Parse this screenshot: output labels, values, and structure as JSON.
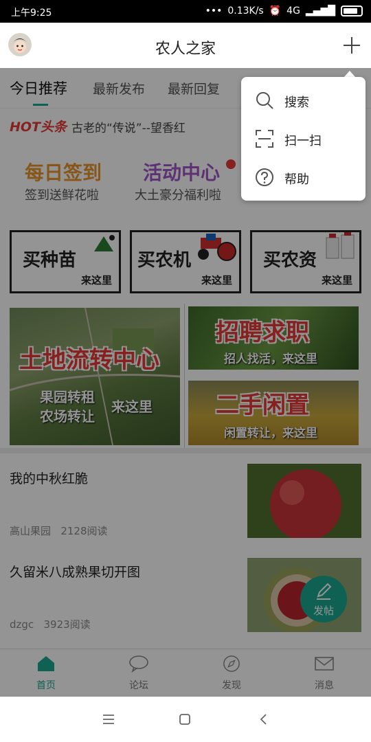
{
  "status_bar": {
    "time": "上午9:25",
    "network_speed": "0.13K/s",
    "network_type": "4G"
  },
  "header": {
    "title": "农人之家"
  },
  "tabs": [
    {
      "label": "今日推荐",
      "active": true
    },
    {
      "label": "最新发布",
      "active": false
    },
    {
      "label": "最新回复",
      "active": false
    }
  ],
  "hot": {
    "logo": "HOT头条",
    "headline": "古老的“传说”--望香红"
  },
  "promo": {
    "sign_in": {
      "title": "每日签到",
      "subtitle": "签到送鲜花啦"
    },
    "activity": {
      "title": "活动中心",
      "subtitle": "大土豪分福利啦"
    }
  },
  "categories": [
    {
      "title": "买种苗",
      "tag": "来这里"
    },
    {
      "title": "买农机",
      "tag": "来这里"
    },
    {
      "title": "买农资",
      "tag": "来这里"
    }
  ],
  "banners": {
    "land": {
      "title": "土地流转中心",
      "line1": "果园转租",
      "line2": "农场转让",
      "tag": "来这里"
    },
    "jobs": {
      "title": "招聘求职",
      "subtitle": "招人找活，来这里"
    },
    "second_hand": {
      "title": "二手闲置",
      "subtitle": "闲置转让，来这里"
    }
  },
  "articles": [
    {
      "title": "我的中秋红脆",
      "author": "高山果园",
      "reads": "2128阅读"
    },
    {
      "title": "久留米八成熟果切开图",
      "author": "dzgc",
      "reads": "3923阅读"
    }
  ],
  "fab": {
    "label": "发帖"
  },
  "bottom_nav": [
    {
      "label": "首页",
      "icon": "home-icon",
      "active": true
    },
    {
      "label": "论坛",
      "icon": "chat-icon",
      "active": false
    },
    {
      "label": "发现",
      "icon": "compass-icon",
      "active": false
    },
    {
      "label": "消息",
      "icon": "mail-icon",
      "active": false
    }
  ],
  "popup_menu": [
    {
      "label": "搜索",
      "icon": "search-icon"
    },
    {
      "label": "扫一扫",
      "icon": "scan-icon"
    },
    {
      "label": "帮助",
      "icon": "help-icon"
    }
  ],
  "colors": {
    "accent": "#1aa88f",
    "hot_red": "#e53935",
    "sign_orange": "#e8952a",
    "activity_purple": "#a057c8"
  }
}
